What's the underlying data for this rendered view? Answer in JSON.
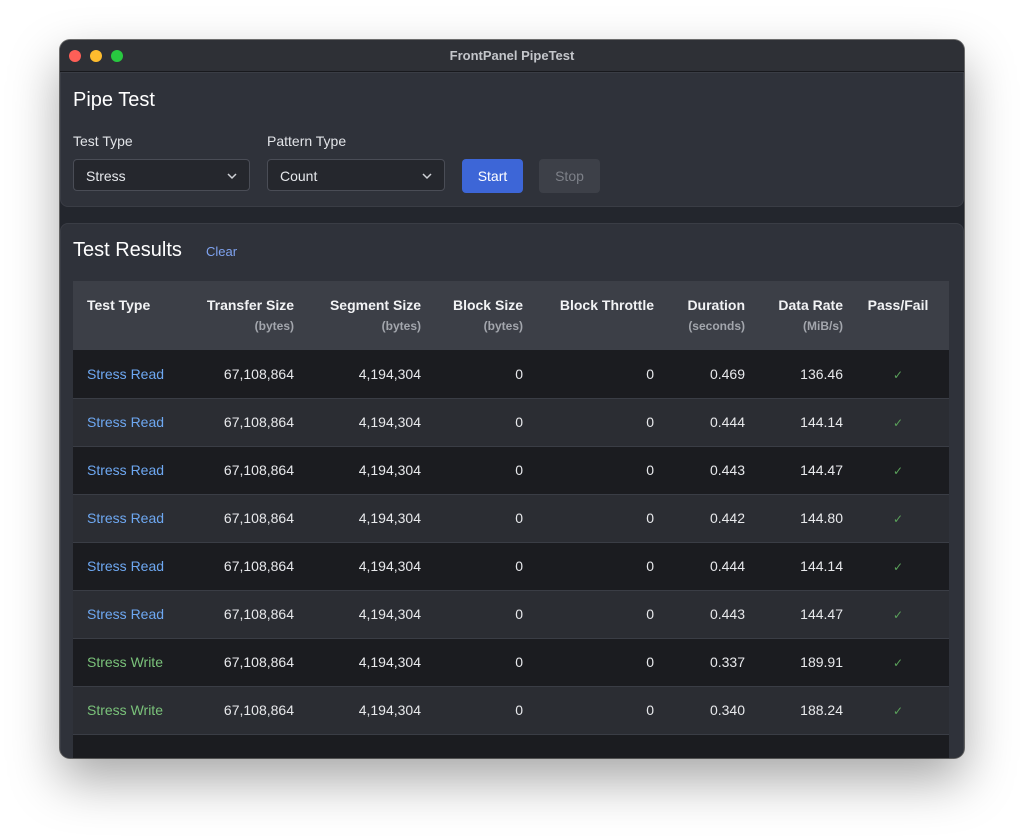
{
  "window": {
    "title": "FrontPanel PipeTest"
  },
  "pipe_test": {
    "title": "Pipe Test",
    "test_type_label": "Test Type",
    "test_type_value": "Stress",
    "pattern_type_label": "Pattern Type",
    "pattern_type_value": "Count",
    "start_label": "Start",
    "stop_label": "Stop"
  },
  "results": {
    "title": "Test Results",
    "clear_label": "Clear",
    "columns": [
      {
        "label": "Test Type",
        "unit": ""
      },
      {
        "label": "Transfer Size",
        "unit": "(bytes)"
      },
      {
        "label": "Segment Size",
        "unit": "(bytes)"
      },
      {
        "label": "Block Size",
        "unit": "(bytes)"
      },
      {
        "label": "Block Throttle",
        "unit": ""
      },
      {
        "label": "Duration",
        "unit": "(seconds)"
      },
      {
        "label": "Data Rate",
        "unit": "(MiB/s)"
      },
      {
        "label": "Pass/Fail",
        "unit": ""
      }
    ],
    "rows": [
      {
        "type": "Stress Read",
        "kind": "read",
        "transfer": "67,108,864",
        "segment": "4,194,304",
        "block": "0",
        "throttle": "0",
        "duration": "0.469",
        "rate": "136.46",
        "pass": "✓"
      },
      {
        "type": "Stress Read",
        "kind": "read",
        "transfer": "67,108,864",
        "segment": "4,194,304",
        "block": "0",
        "throttle": "0",
        "duration": "0.444",
        "rate": "144.14",
        "pass": "✓"
      },
      {
        "type": "Stress Read",
        "kind": "read",
        "transfer": "67,108,864",
        "segment": "4,194,304",
        "block": "0",
        "throttle": "0",
        "duration": "0.443",
        "rate": "144.47",
        "pass": "✓"
      },
      {
        "type": "Stress Read",
        "kind": "read",
        "transfer": "67,108,864",
        "segment": "4,194,304",
        "block": "0",
        "throttle": "0",
        "duration": "0.442",
        "rate": "144.80",
        "pass": "✓"
      },
      {
        "type": "Stress Read",
        "kind": "read",
        "transfer": "67,108,864",
        "segment": "4,194,304",
        "block": "0",
        "throttle": "0",
        "duration": "0.444",
        "rate": "144.14",
        "pass": "✓"
      },
      {
        "type": "Stress Read",
        "kind": "read",
        "transfer": "67,108,864",
        "segment": "4,194,304",
        "block": "0",
        "throttle": "0",
        "duration": "0.443",
        "rate": "144.47",
        "pass": "✓"
      },
      {
        "type": "Stress Write",
        "kind": "write",
        "transfer": "67,108,864",
        "segment": "4,194,304",
        "block": "0",
        "throttle": "0",
        "duration": "0.337",
        "rate": "189.91",
        "pass": "✓"
      },
      {
        "type": "Stress Write",
        "kind": "write",
        "transfer": "67,108,864",
        "segment": "4,194,304",
        "block": "0",
        "throttle": "0",
        "duration": "0.340",
        "rate": "188.24",
        "pass": "✓"
      }
    ]
  }
}
